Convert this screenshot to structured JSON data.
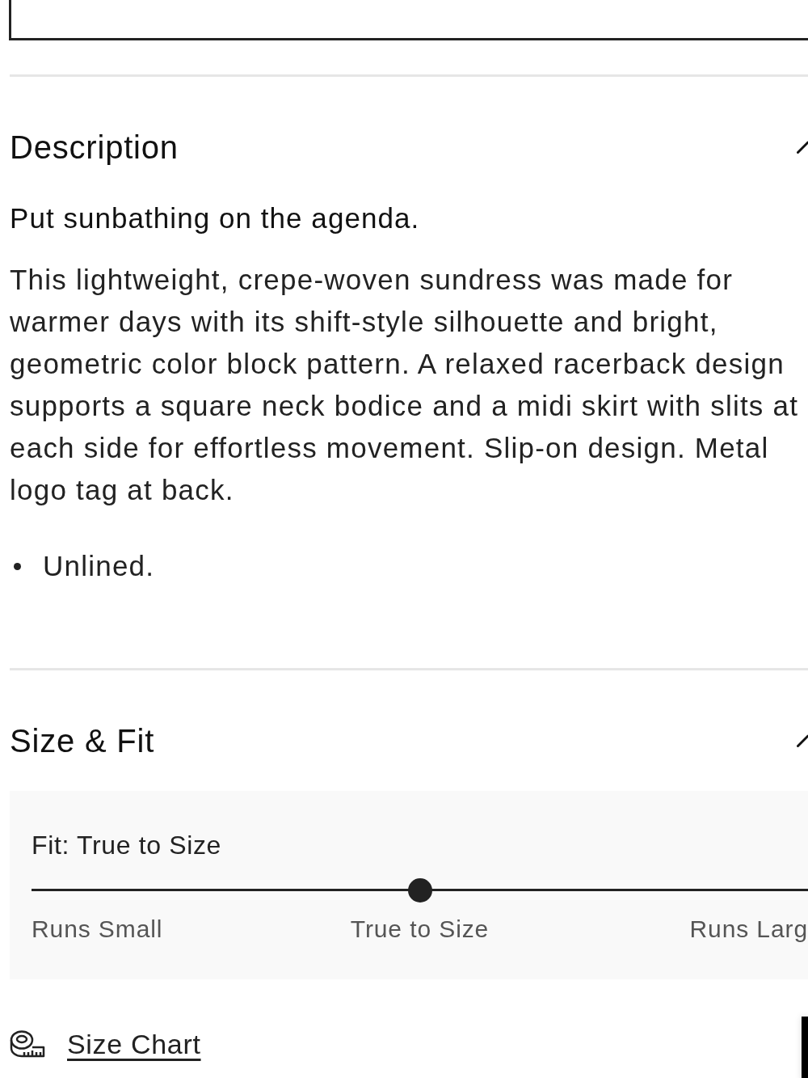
{
  "sections": [
    {
      "kind": "description",
      "title": "Description",
      "expanded": true,
      "headline": "Put sunbathing on the agenda.",
      "body": "This lightweight, crepe-woven sundress was made for\nwarmer days with its shift-style silhouette and bright,\ngeometric color block pattern. A relaxed racerback design\nsupports a square neck bodice and a midi skirt with slits at\neach side for effortless movement. Slip-on design. Metal\nlogo tag at back.",
      "bullets": [
        "Unlined."
      ]
    },
    {
      "kind": "size_fit",
      "title": "Size & Fit",
      "expanded": true,
      "fit": {
        "title": "Fit: True to Size",
        "level": 0.5,
        "labels": [
          "Runs Small",
          "True to Size",
          "Runs Larg"
        ]
      }
    }
  ],
  "size_chart": {
    "label": "Size Chart"
  }
}
